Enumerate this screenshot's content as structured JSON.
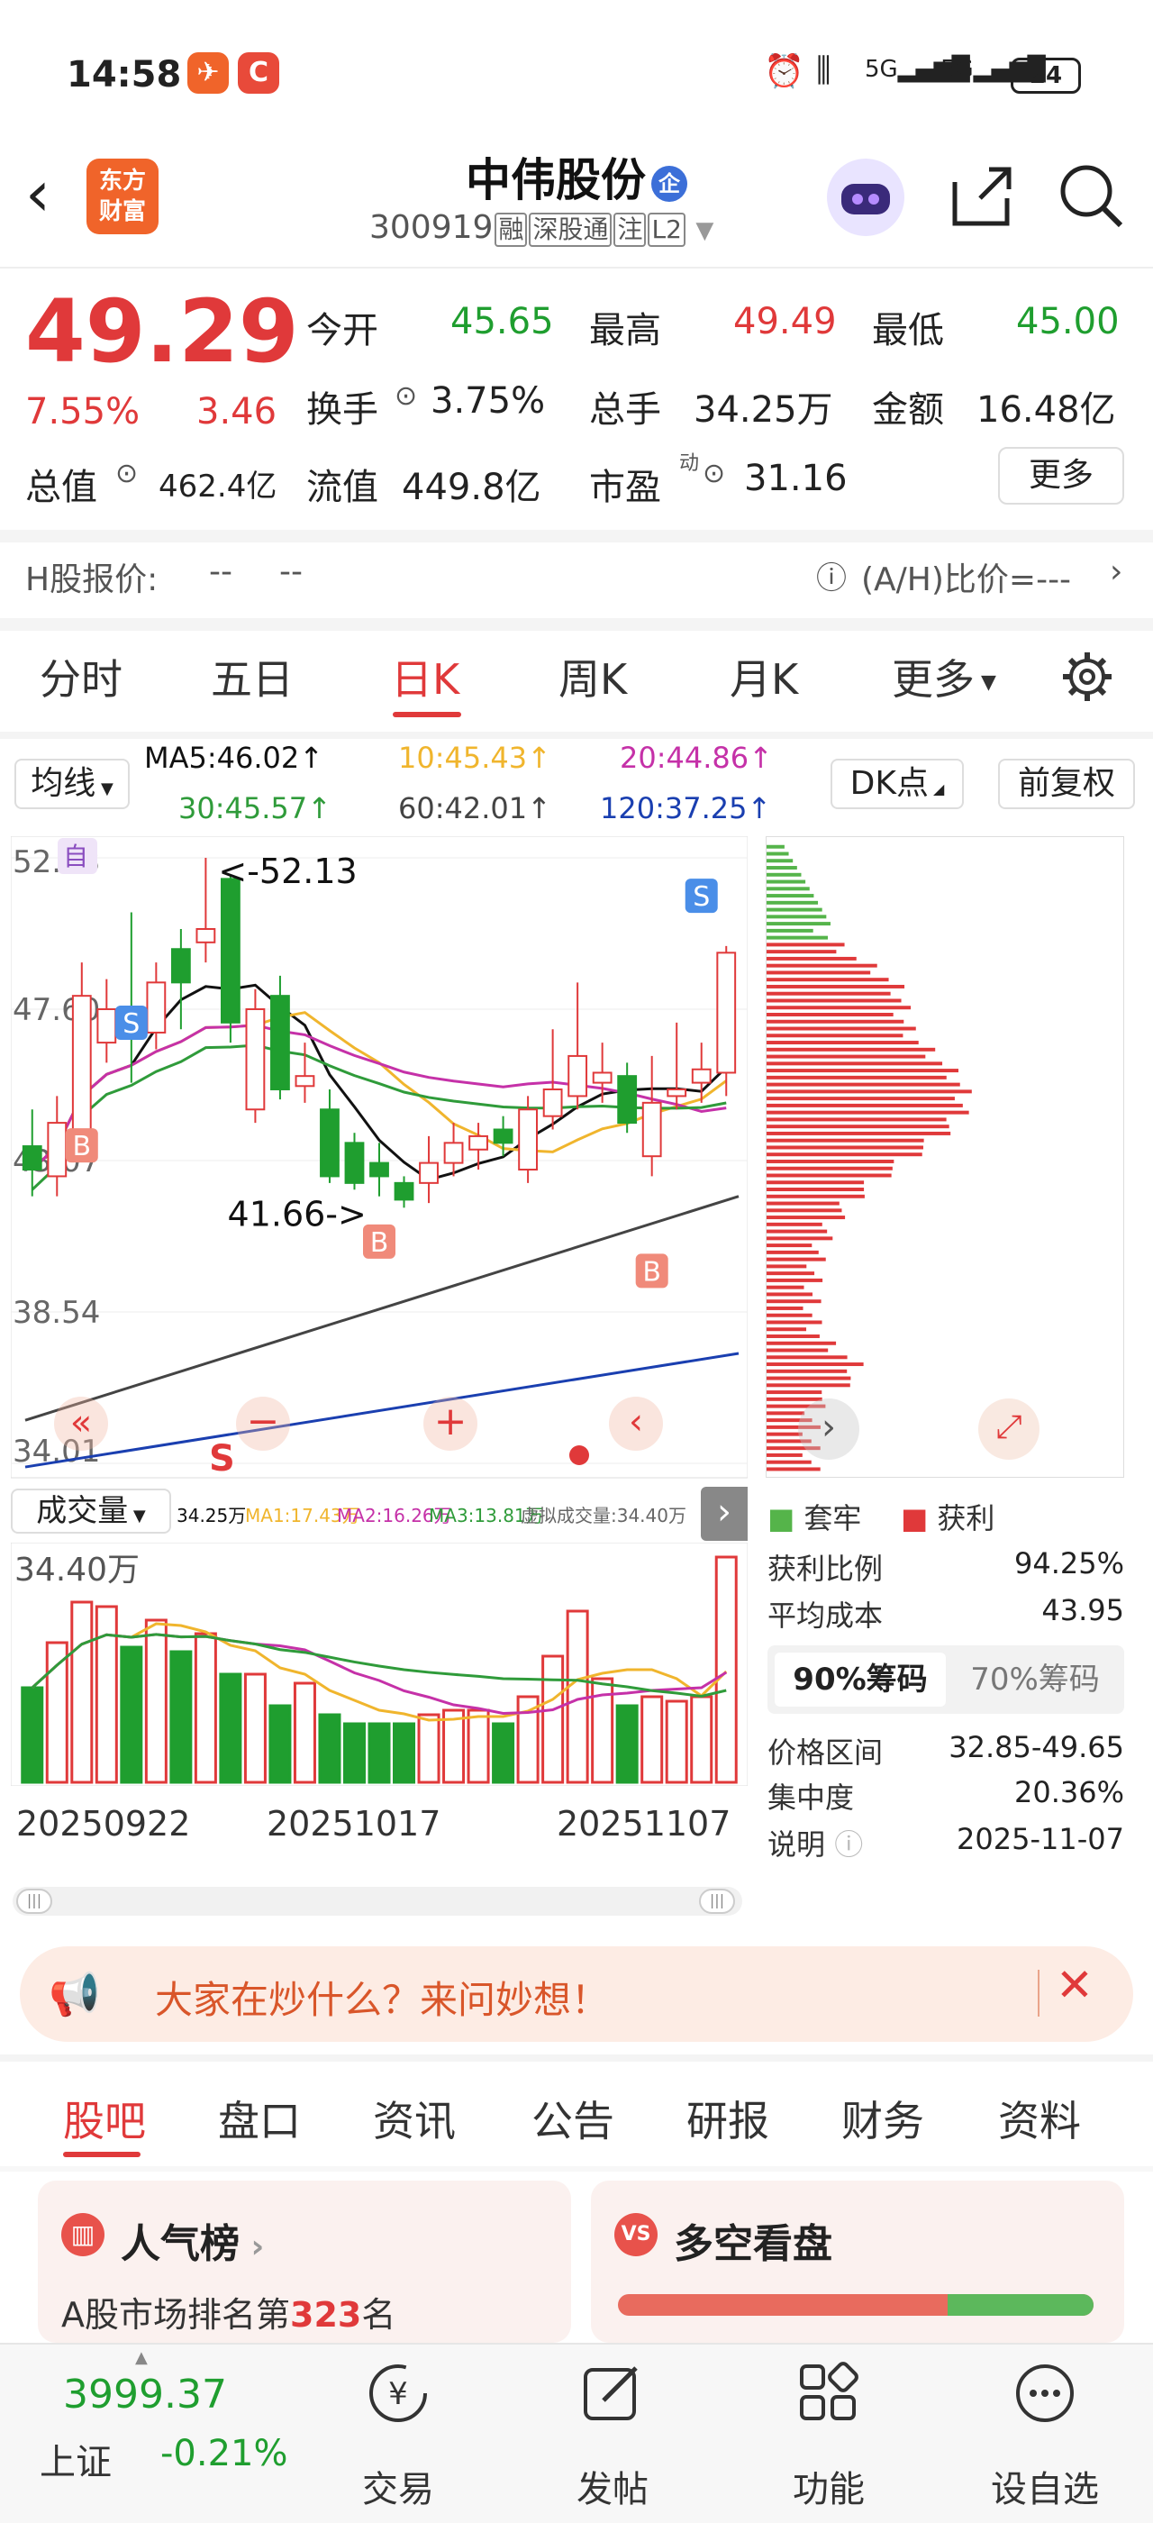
{
  "status": {
    "time": "14:58",
    "battery": "24",
    "net1": "5G",
    "net2": "5G"
  },
  "header": {
    "logo_line1": "东方",
    "logo_line2": "财富",
    "name": "中伟股份",
    "name_badge": "企",
    "code": "300919",
    "tags": [
      "融",
      "深股通",
      "注",
      "L2"
    ]
  },
  "quote": {
    "price": "49.29",
    "change_pct": "7.55%",
    "change": "3.46",
    "open_label": "今开",
    "open": "45.65",
    "high_label": "最高",
    "high": "49.49",
    "low_label": "最低",
    "low": "45.00",
    "turnover_label": "换手",
    "turnover": "3.75%",
    "volume_label": "总手",
    "volume": "34.25万",
    "amount_label": "金额",
    "amount": "16.48亿",
    "mktcap_label": "总值",
    "mktcap": "462.4亿",
    "float_label": "流值",
    "float": "449.8亿",
    "pe_label": "市盈",
    "pe_sup": "动",
    "pe": "31.16",
    "more_button": "更多"
  },
  "hshare": {
    "label": "H股报价:",
    "v1": "--",
    "v2": "--",
    "ratio": "(A/H)比价=---"
  },
  "tabs": {
    "items": [
      "分时",
      "五日",
      "日K",
      "周K",
      "月K",
      "更多"
    ],
    "active": "日K"
  },
  "indicators": {
    "select": "均线",
    "ma5": "MA5:46.02↑",
    "ma10": "10:45.43↑",
    "ma20": "20:44.86↑",
    "ma30": "30:45.57↑",
    "ma60": "60:42.01↑",
    "ma120": "120:37.25↑",
    "dk": "DK点",
    "adjust": "前复权"
  },
  "colors": {
    "up": "#e0393a",
    "down": "#1f9e2f",
    "ma5": "#111111",
    "ma10": "#f0b52d",
    "ma20": "#c531a8",
    "ma30": "#2f9b3a",
    "ma60": "#444444",
    "ma120": "#1a3fb0"
  },
  "kline": {
    "y_labels": [
      "52.13",
      "47.60",
      "43.07",
      "38.54",
      "34.01"
    ],
    "max_label": "<-52.13",
    "min_label": "41.66->",
    "tag_zi": "自"
  },
  "chart_data": {
    "type": "candlestick",
    "ylim": [
      34.01,
      52.13
    ],
    "candles": [
      {
        "o": 43.5,
        "c": 42.8,
        "h": 44.6,
        "l": 42.0
      },
      {
        "o": 42.6,
        "c": 44.2,
        "h": 45.0,
        "l": 42.0
      },
      {
        "o": 44.0,
        "c": 48.0,
        "h": 49.0,
        "l": 43.8
      },
      {
        "o": 46.6,
        "c": 47.6,
        "h": 48.5,
        "l": 46.0
      },
      {
        "o": 47.4,
        "c": 47.0,
        "h": 50.5,
        "l": 45.4
      },
      {
        "o": 46.9,
        "c": 48.4,
        "h": 49.0,
        "l": 46.4
      },
      {
        "o": 49.4,
        "c": 48.4,
        "h": 50.0,
        "l": 47.0
      },
      {
        "o": 49.6,
        "c": 50.0,
        "h": 52.13,
        "l": 49.0
      },
      {
        "o": 51.5,
        "c": 47.2,
        "h": 51.6,
        "l": 46.6
      },
      {
        "o": 44.6,
        "c": 47.6,
        "h": 48.2,
        "l": 44.2
      },
      {
        "o": 48.0,
        "c": 45.2,
        "h": 48.6,
        "l": 44.9
      },
      {
        "o": 45.3,
        "c": 45.6,
        "h": 46.6,
        "l": 44.8
      },
      {
        "o": 44.6,
        "c": 42.6,
        "h": 45.2,
        "l": 42.4
      },
      {
        "o": 43.6,
        "c": 42.4,
        "h": 43.9,
        "l": 42.2
      },
      {
        "o": 43.0,
        "c": 42.6,
        "h": 43.6,
        "l": 42.0
      },
      {
        "o": 42.4,
        "c": 41.9,
        "h": 42.6,
        "l": 41.66
      },
      {
        "o": 42.4,
        "c": 43.0,
        "h": 43.8,
        "l": 41.8
      },
      {
        "o": 43.0,
        "c": 43.6,
        "h": 44.2,
        "l": 42.6
      },
      {
        "o": 43.4,
        "c": 43.8,
        "h": 44.2,
        "l": 42.8
      },
      {
        "o": 44.0,
        "c": 43.6,
        "h": 44.4,
        "l": 43.2
      },
      {
        "o": 42.8,
        "c": 44.6,
        "h": 45.0,
        "l": 42.4
      },
      {
        "o": 44.4,
        "c": 45.2,
        "h": 47.0,
        "l": 44.0
      },
      {
        "o": 45.0,
        "c": 46.2,
        "h": 48.4,
        "l": 44.6
      },
      {
        "o": 45.4,
        "c": 45.7,
        "h": 46.6,
        "l": 44.8
      },
      {
        "o": 45.6,
        "c": 44.2,
        "h": 46.0,
        "l": 43.9
      },
      {
        "o": 43.2,
        "c": 44.8,
        "h": 46.2,
        "l": 42.6
      },
      {
        "o": 45.0,
        "c": 45.2,
        "h": 47.2,
        "l": 44.6
      },
      {
        "o": 45.4,
        "c": 45.8,
        "h": 46.6,
        "l": 44.8
      },
      {
        "o": 45.7,
        "c": 49.29,
        "h": 49.49,
        "l": 45.0
      }
    ],
    "volume": {
      "labels": [
        "34.25万",
        "MA1:17.43万",
        "MA2:16.26万",
        "MA3:13.81万",
        "虚拟成交量:34.40万"
      ],
      "max_label": "34.40万",
      "bars": [
        0.42,
        0.62,
        0.8,
        0.78,
        0.6,
        0.72,
        0.58,
        0.66,
        0.48,
        0.48,
        0.34,
        0.44,
        0.3,
        0.26,
        0.26,
        0.26,
        0.3,
        0.32,
        0.32,
        0.26,
        0.38,
        0.56,
        0.76,
        0.46,
        0.34,
        0.38,
        0.36,
        0.38,
        1.0
      ]
    },
    "x_labels": [
      "20250922",
      "20251017",
      "20251107"
    ]
  },
  "chips": {
    "legend_hold": "套牢",
    "legend_profit": "获利",
    "profit_ratio_label": "获利比例",
    "profit_ratio": "94.25%",
    "avg_cost_label": "平均成本",
    "avg_cost": "43.95",
    "tab_90": "90%筹码",
    "tab_70": "70%筹码",
    "range_label": "价格区间",
    "range": "32.85-49.65",
    "concentration_label": "集中度",
    "concentration": "20.36%",
    "note_label": "说明",
    "note": "2025-11-07"
  },
  "volhead": {
    "select": "成交量"
  },
  "banner": {
    "text": "大家在炒什么？来问妙想！"
  },
  "section_tabs": {
    "items": [
      "股吧",
      "盘口",
      "资讯",
      "公告",
      "研报",
      "财务",
      "资料"
    ],
    "active": "股吧"
  },
  "cards": {
    "left_title": "人气榜",
    "left_text_pre": "A股市场排名第",
    "left_rank": "323",
    "left_text_post": "名",
    "right_title": "多空看盘"
  },
  "footer": {
    "index_value": "3999.37",
    "index_name": "上证",
    "index_change": "-0.21%",
    "items": [
      "交易",
      "发帖",
      "功能",
      "设自选"
    ]
  }
}
